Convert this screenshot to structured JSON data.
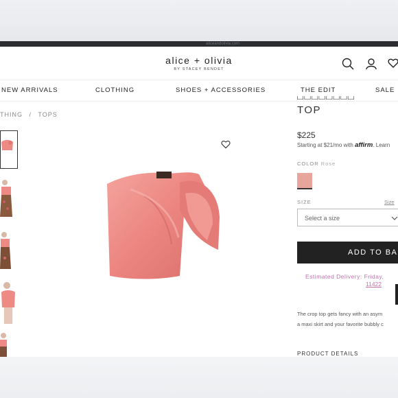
{
  "browser": {
    "url_fragment": "aliceandolivia.com"
  },
  "header": {
    "brand": "alice + olivia",
    "sub_brand": "BY STACEY BENDET",
    "icons": [
      "search-icon",
      "account-icon",
      "heart-icon"
    ]
  },
  "nav": {
    "items": [
      "NEW ARRIVALS",
      "CLOTHING",
      "SHOES + ACCESSORIES",
      "THE EDIT",
      "SALE"
    ]
  },
  "breadcrumb": {
    "parent": "THING",
    "separator": "/",
    "current": "TOPS"
  },
  "product": {
    "title_partial": "TOP",
    "price": "$225",
    "affirm_prefix": "Starting at $21/mo with",
    "affirm_brand": "affirm",
    "affirm_suffix": ". Learn",
    "color_label": "COLOR",
    "color_value": "Rose",
    "swatch_color": "#e7a59c",
    "size_label": "SIZE",
    "size_guide": "Size",
    "size_placeholder": "Select a size",
    "add_to_bag": "ADD TO BA",
    "delivery_line1": "Estimated Delivery: Friday,",
    "delivery_line2": "11422",
    "description_line1": "The crop top gets fancy with an asym",
    "description_line2": "a maxi skirt and your favorite bubbly c",
    "details_heading": "PRODUCT DETAILS"
  },
  "colors": {
    "accent_pink": "#c46fb0",
    "button_dark": "#222222",
    "product_pink": "#ee8a84"
  }
}
